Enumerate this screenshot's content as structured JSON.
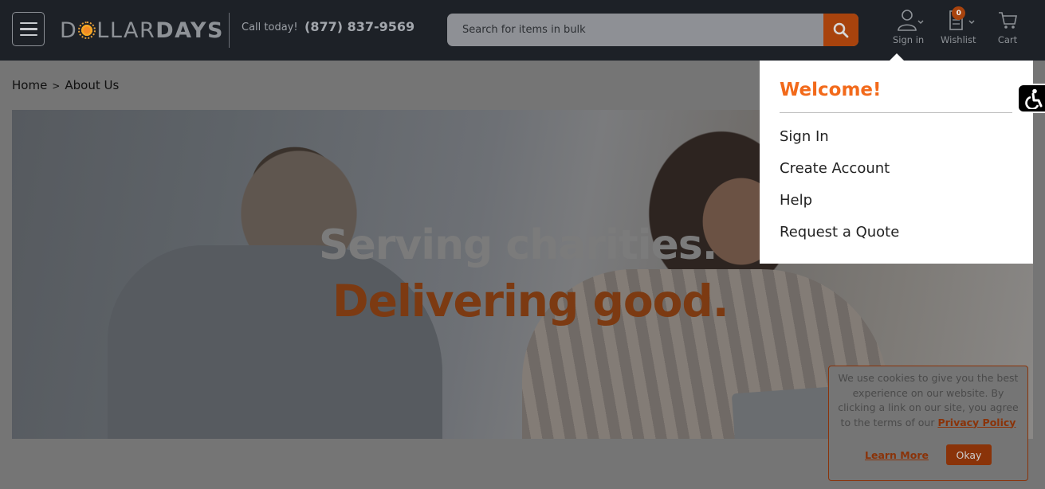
{
  "header": {
    "logo_part1": "D",
    "logo_part2": "LLAR",
    "logo_part3": "DAYS",
    "call_label": "Call today!",
    "phone": "(877) 837-9569",
    "search_placeholder": "Search for items in bulk",
    "signin_label": "Sign in",
    "wishlist_label": "Wishlist",
    "wishlist_count": "0",
    "cart_label": "Cart"
  },
  "breadcrumb": {
    "home": "Home",
    "separator": ">",
    "current": "About Us"
  },
  "hero": {
    "line1": "Serving charities.",
    "line2": "Delivering good."
  },
  "dropdown": {
    "welcome": "Welcome!",
    "items": [
      "Sign In",
      "Create Account",
      "Help",
      "Request a Quote"
    ]
  },
  "cookie": {
    "text": "We use cookies to give you the best experience on our website. By clicking a link on our site, you agree to the terms of our",
    "policy_link": "Privacy Policy",
    "learn_more": "Learn More",
    "okay": "Okay"
  },
  "colors": {
    "header_bg": "#1d2127",
    "accent_orange": "#f26a1b",
    "dimmed_accent": "#a8430d"
  }
}
